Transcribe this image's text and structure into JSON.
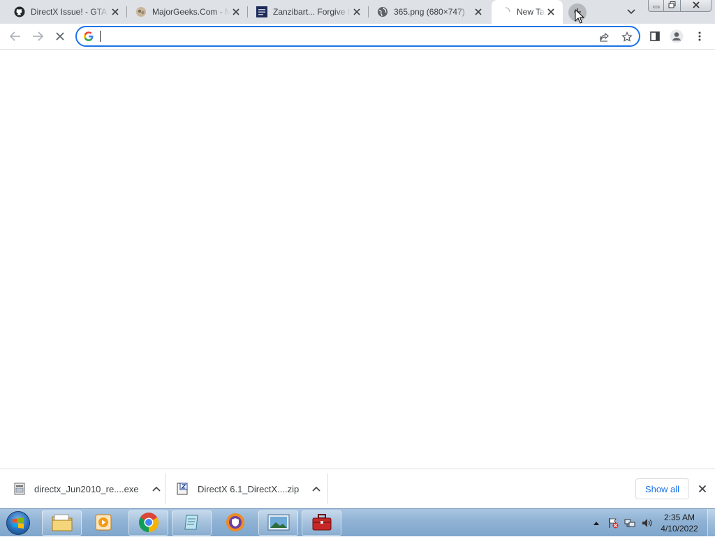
{
  "tabs": [
    {
      "title": "DirectX Issue! - GTA",
      "favicon": "github-icon",
      "active": false
    },
    {
      "title": "MajorGeeks.Com - M",
      "favicon": "majorgeeks-icon",
      "active": false
    },
    {
      "title": "Zanzibart... Forgive M",
      "favicon": "zanzibart-icon",
      "active": false
    },
    {
      "title": "365.png (680×747)",
      "favicon": "globe-icon",
      "active": false
    },
    {
      "title": "New Tab",
      "favicon": "loading-spinner-icon",
      "active": true
    }
  ],
  "tabstrip": {
    "new_tab_icon": "plus-icon",
    "tab_search_icon": "chevron-down-icon"
  },
  "window_controls": [
    "minimize-icon",
    "restore-icon",
    "close-icon"
  ],
  "toolbar": {
    "back_icon": "arrow-left-icon",
    "forward_icon": "arrow-right-icon",
    "stop_icon": "stop-x-icon",
    "omnibox": {
      "value": "",
      "placeholder": "",
      "icon": "google-g-icon"
    },
    "share_icon": "share-icon",
    "bookmark_icon": "star-icon",
    "side_panel_icon": "side-panel-icon",
    "profile_icon": "profile-icon",
    "menu_icon": "kebab-menu-icon"
  },
  "downloads": {
    "items": [
      {
        "filename": "directx_Jun2010_re....exe",
        "icon": "exe-file-icon"
      },
      {
        "filename": "DirectX 6.1_DirectX....zip",
        "icon": "zip-file-icon"
      }
    ],
    "show_all_label": "Show all",
    "close_icon": "close-icon"
  },
  "taskbar": {
    "start_icon": "windows-start-orb-icon",
    "apps": [
      {
        "name": "file-explorer-icon"
      },
      {
        "name": "media-player-icon"
      },
      {
        "name": "chrome-icon"
      },
      {
        "name": "notepad-icon"
      },
      {
        "name": "vpn-shield-icon"
      },
      {
        "name": "image-viewer-icon"
      },
      {
        "name": "toolbox-icon"
      }
    ],
    "tray_icons": [
      "show-hidden-icons-icon",
      "action-center-flag-icon",
      "network-icon",
      "volume-icon"
    ],
    "clock": {
      "time": "2:35 AM",
      "date": "4/10/2022"
    }
  },
  "colors": {
    "accent": "#1a73e8",
    "tabstrip": "#dee1e6",
    "taskbar": "#8fb2d4"
  }
}
